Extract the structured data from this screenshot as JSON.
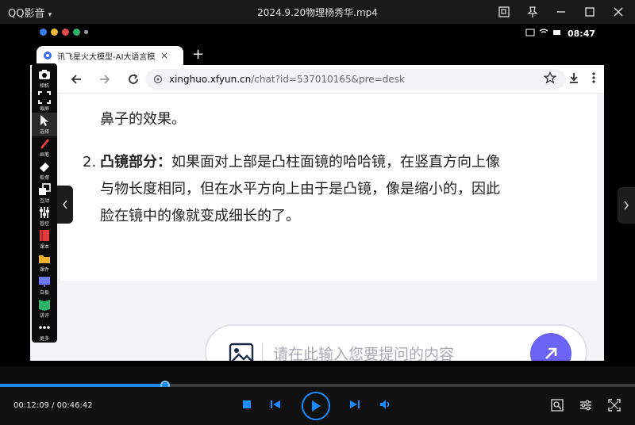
{
  "titlebar": {
    "app_name": "QQ影音",
    "file_name": "2024.9.20物理杨秀华.mp4"
  },
  "tablet": {
    "status_time": "08:47"
  },
  "browser": {
    "tab_title": "讯飞星火大模型-AI大语言模",
    "tab_close": "×",
    "new_tab": "+",
    "url_host": "xinghuo.xfyun.cn",
    "url_path": "/chat?id=537010165&pre=desk"
  },
  "content": {
    "line0": "鼻子的效果。",
    "item_number": "2.",
    "item_bold": "凸镜部分",
    "item_colon": "：",
    "line1_rest": "如果面对上部是凸柱面镜的哈哈镜，在竖直方向上像",
    "line2": "与物长度相同，但在水平方向上由于是凸镜，像是缩小的，因此",
    "line3": "脸在镜中的像就变成细长的了。"
  },
  "input": {
    "placeholder": "请在此输入您要提问的内容"
  },
  "toolbar": {
    "items": [
      {
        "label": "相机",
        "icon": "camera-icon"
      },
      {
        "label": "裁屏",
        "icon": "crop-icon"
      },
      {
        "label": "选择",
        "icon": "cursor-icon"
      },
      {
        "label": "画笔",
        "icon": "pen-icon"
      },
      {
        "label": "板擦",
        "icon": "eraser-icon"
      },
      {
        "label": "互动",
        "icon": "interact-icon"
      },
      {
        "label": "管控",
        "icon": "control-icon"
      },
      {
        "label": "课本",
        "icon": "book-icon"
      },
      {
        "label": "课件",
        "icon": "folder-icon"
      },
      {
        "label": "白板",
        "icon": "whiteboard-icon"
      },
      {
        "label": "讲评",
        "icon": "review-icon"
      },
      {
        "label": "更多",
        "icon": "more-icon"
      }
    ]
  },
  "player": {
    "time_text": "00:12:09 / 00:46:42",
    "progress": 0.26,
    "accent": "#1c88e8"
  },
  "colors": {
    "send_button": "#6b63f5",
    "page_bg": "#f4f4f6"
  }
}
